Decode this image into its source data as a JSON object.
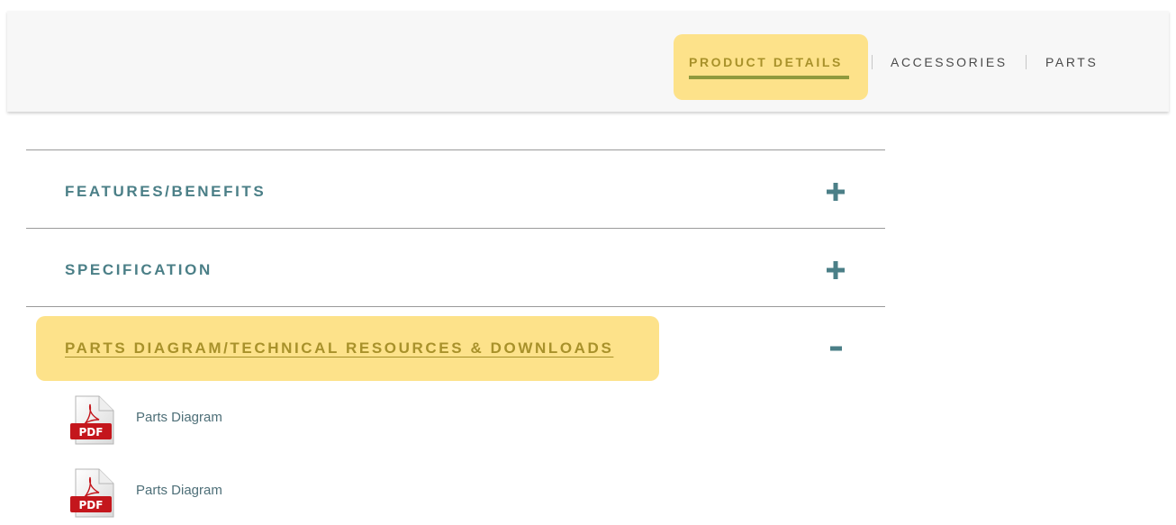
{
  "tabs": [
    {
      "label": "PRODUCT DETAILS",
      "active": true
    },
    {
      "label": "ACCESSORIES",
      "active": false
    },
    {
      "label": "PARTS",
      "active": false
    }
  ],
  "sections": [
    {
      "title": "FEATURES/BENEFITS",
      "toggle": "+",
      "expanded": false
    },
    {
      "title": "SPECIFICATION",
      "toggle": "+",
      "expanded": false
    },
    {
      "title": "PARTS DIAGRAM/TECHNICAL RESOURCES & DOWNLOADS",
      "toggle": "−",
      "expanded": true
    }
  ],
  "downloads": [
    {
      "label": "Parts Diagram",
      "icon": "pdf-icon",
      "icon_text": "PDF"
    },
    {
      "label": "Parts Diagram",
      "icon": "pdf-icon",
      "icon_text": "PDF"
    }
  ],
  "colors": {
    "highlight": "#fde28a",
    "accent_text": "#a8912a",
    "teal_text": "#4b7f87",
    "underline": "#8f9a3d",
    "pdf_red": "#c4161c"
  }
}
